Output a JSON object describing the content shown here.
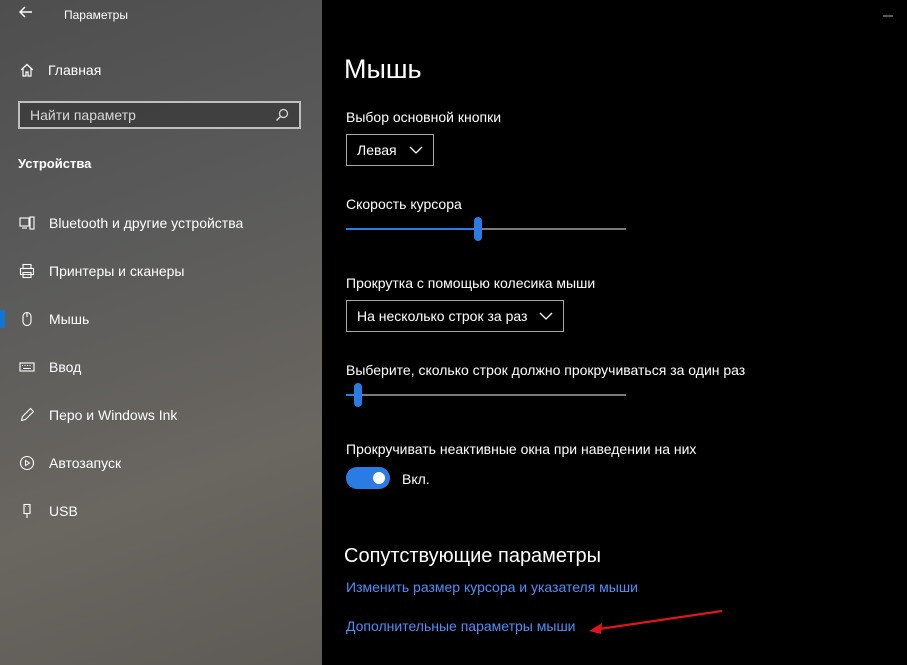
{
  "window": {
    "title": "Параметры"
  },
  "sidebar": {
    "home_label": "Главная",
    "search_placeholder": "Найти параметр",
    "section_title": "Устройства",
    "items": [
      {
        "label": "Bluetooth и другие устройства",
        "icon": "bluetooth-devices-icon",
        "active": false
      },
      {
        "label": "Принтеры и сканеры",
        "icon": "printer-icon",
        "active": false
      },
      {
        "label": "Мышь",
        "icon": "mouse-icon",
        "active": true
      },
      {
        "label": "Ввод",
        "icon": "keyboard-icon",
        "active": false
      },
      {
        "label": "Перо и Windows Ink",
        "icon": "pen-icon",
        "active": false
      },
      {
        "label": "Автозапуск",
        "icon": "autoplay-icon",
        "active": false
      },
      {
        "label": "USB",
        "icon": "usb-icon",
        "active": false
      }
    ]
  },
  "main": {
    "title": "Мышь",
    "primary_button_label": "Выбор основной кнопки",
    "primary_button_value": "Левая",
    "cursor_speed_label": "Скорость курсора",
    "cursor_speed_value": 0.47,
    "wheel_scroll_label": "Прокрутка с помощью колесика мыши",
    "wheel_scroll_value": "На несколько строк за раз",
    "lines_label": "Выберите, сколько строк должно прокручиваться за один раз",
    "lines_value": 0.03,
    "inactive_scroll_label": "Прокручивать неактивные окна при наведении на них",
    "inactive_scroll_state": "Вкл.",
    "inactive_scroll_on": true,
    "related_title": "Сопутствующие параметры",
    "link_cursor_size": "Изменить размер курсора и указателя мыши",
    "link_additional": "Дополнительные параметры мыши"
  },
  "colors": {
    "accent": "#2b7be4",
    "link": "#4f8ef7",
    "annotation_arrow": "#e0151b"
  }
}
